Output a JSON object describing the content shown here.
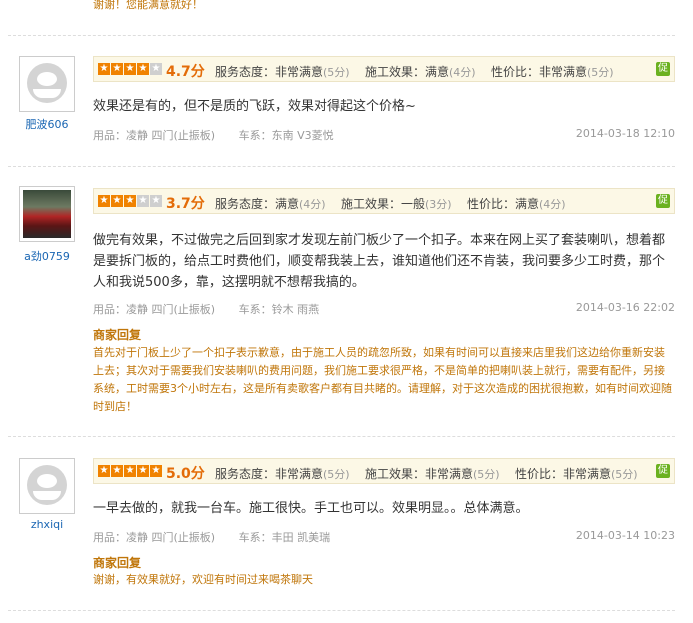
{
  "top_reply": "谢谢！您能满意就好！",
  "reviews": [
    {
      "user": "肥波606",
      "stars": 4,
      "score": "4.7分",
      "service": "服务态度：非常满意",
      "service_pts": "(5分)",
      "effect": "施工效果：满意",
      "effect_pts": "(4分)",
      "value": "性价比：非常满意",
      "value_pts": "(5分)",
      "badge": "促",
      "content": "效果还是有的，但不是质的飞跃，效果对得起这个价格~",
      "product": "用品：凌静 四门(止振板)",
      "car": "车系：东南 V3菱悦",
      "date": "2014-03-18 12:10"
    },
    {
      "user": "a劲0759",
      "stars": 3,
      "score": "3.7分",
      "service": "服务态度：满意",
      "service_pts": "(4分)",
      "effect": "施工效果：一般",
      "effect_pts": "(3分)",
      "value": "性价比：满意",
      "value_pts": "(4分)",
      "badge": "促",
      "content": "做完有效果，不过做完之后回到家才发现左前门板少了一个扣子。本来在网上买了套装喇叭，想着都是要拆门板的，给点工时费他们，顺变帮我装上去，谁知道他们还不肯装，我问要多少工时费，那个人和我说500多，靠，这摆明就不想帮我搞的。",
      "product": "用品：凌静 四门(止振板)",
      "car": "车系：铃木 雨燕",
      "date": "2014-03-16 22:02",
      "reply_title": "商家回复",
      "reply": "首先对于门板上少了一个扣子表示歉意，由于施工人员的疏忽所致，如果有时间可以直接来店里我们这边给你重新安装上去；其次对于需要我们安装喇叭的费用问题，我们施工要求很严格，不是简单的把喇叭装上就行，需要有配件，另接系统，工时需要3个小时左右，这是所有卖歌客户都有目共睹的。请理解，对于这次造成的困扰很抱歉，如有时间欢迎随时到店！"
    },
    {
      "user": "zhxiqi",
      "stars": 5,
      "score": "5.0分",
      "service": "服务态度：非常满意",
      "service_pts": "(5分)",
      "effect": "施工效果：非常满意",
      "effect_pts": "(5分)",
      "value": "性价比：非常满意",
      "value_pts": "(5分)",
      "badge": "促",
      "content": "一早去做的，就我一台车。施工很快。手工也可以。效果明显。。总体满意。",
      "product": "用品：凌静 四门(止振板)",
      "car": "车系：丰田 凯美瑞",
      "date": "2014-03-14 10:23",
      "reply_title": "商家回复",
      "reply": "谢谢，有效果就好，欢迎有时间过来喝茶聊天"
    }
  ]
}
